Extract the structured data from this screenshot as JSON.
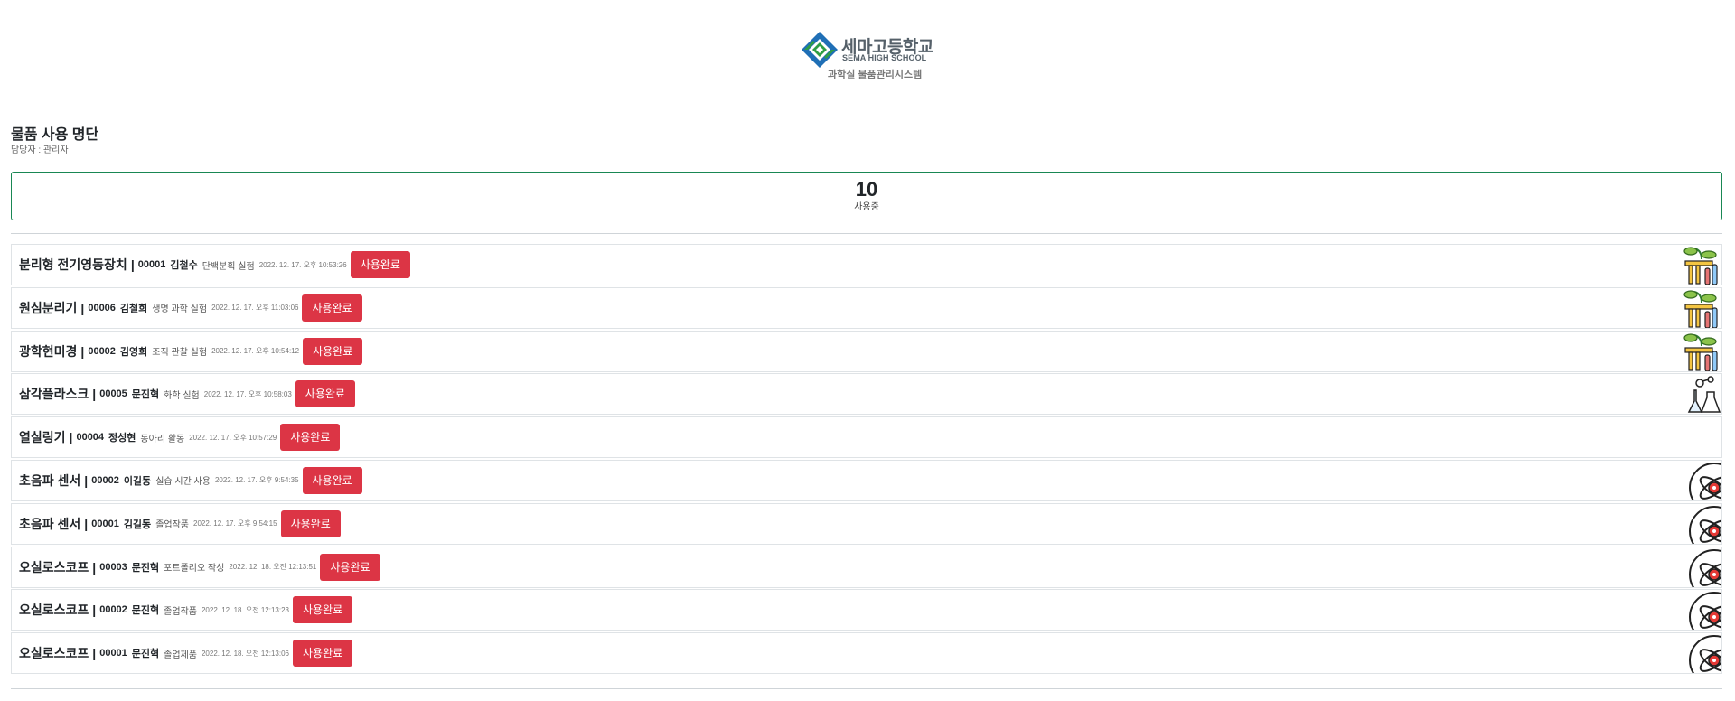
{
  "header": {
    "school_name": "세마고등학교",
    "school_name_en": "SEMA HIGH SCHOOL",
    "system_name": "과학실 물품관리시스템",
    "logo_colors": {
      "blue": "#1f6fb6",
      "green": "#2e9e45",
      "gray": "#556069"
    }
  },
  "page": {
    "title": "물품 사용 명단",
    "manager": "담당자 : 관리자"
  },
  "summary": {
    "count": "10",
    "label": "사용중",
    "border_color": "#198754"
  },
  "button_color": "#dc3545",
  "items": [
    {
      "name": "분리형 전기영동장치",
      "sep": "|",
      "no": "00001",
      "user": "김철수",
      "purpose": "단백분획 실험",
      "time": "2022. 12. 17. 오후 10:53:26",
      "button": "사용완료",
      "icon": "plant-test-tube-icon"
    },
    {
      "name": "원심분리기",
      "sep": "|",
      "no": "00006",
      "user": "김철희",
      "purpose": "생명 과학 실험",
      "time": "2022. 12. 17. 오후 11:03:06",
      "button": "사용완료",
      "icon": "plant-test-tube-icon"
    },
    {
      "name": "광학현미경",
      "sep": "|",
      "no": "00002",
      "user": "김영희",
      "purpose": "조직 관찰 실험",
      "time": "2022. 12. 17. 오후 10:54:12",
      "button": "사용완료",
      "icon": "plant-test-tube-icon"
    },
    {
      "name": "삼각플라스크",
      "sep": "|",
      "no": "00005",
      "user": "문진혁",
      "purpose": "화학 실험",
      "time": "2022. 12. 17. 오후 10:58:03",
      "button": "사용완료",
      "icon": "chemistry-flask-icon"
    },
    {
      "name": "열실링기",
      "sep": "|",
      "no": "00004",
      "user": "정성현",
      "purpose": "동아리 활동",
      "time": "2022. 12. 17. 오후 10:57:29",
      "button": "사용완료",
      "icon": ""
    },
    {
      "name": "초음파 센서",
      "sep": "|",
      "no": "00002",
      "user": "이길동",
      "purpose": "실습 시간 사용",
      "time": "2022. 12. 17. 오후 9:54:35",
      "button": "사용완료",
      "icon": "atom-icon"
    },
    {
      "name": "초음파 센서",
      "sep": "|",
      "no": "00001",
      "user": "김길동",
      "purpose": "졸업작품",
      "time": "2022. 12. 17. 오후 9:54:15",
      "button": "사용완료",
      "icon": "atom-icon"
    },
    {
      "name": "오실로스코프",
      "sep": "|",
      "no": "00003",
      "user": "문진혁",
      "purpose": "포트폴리오 작성",
      "time": "2022. 12. 18. 오전 12:13:51",
      "button": "사용완료",
      "icon": "atom-icon"
    },
    {
      "name": "오실로스코프",
      "sep": "|",
      "no": "00002",
      "user": "문진혁",
      "purpose": "졸업작품",
      "time": "2022. 12. 18. 오전 12:13:23",
      "button": "사용완료",
      "icon": "atom-icon"
    },
    {
      "name": "오실로스코프",
      "sep": "|",
      "no": "00001",
      "user": "문진혁",
      "purpose": "졸업제품",
      "time": "2022. 12. 18. 오전 12:13:06",
      "button": "사용완료",
      "icon": "atom-icon"
    }
  ]
}
